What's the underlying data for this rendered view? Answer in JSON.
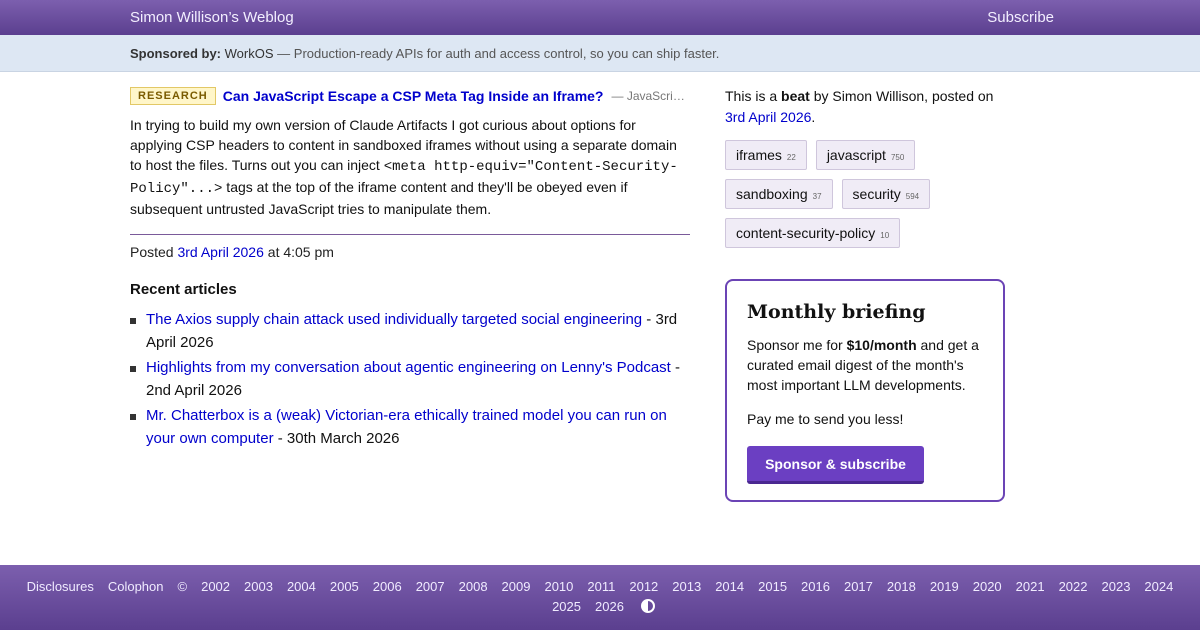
{
  "header": {
    "site_title": "Simon Willison’s Weblog",
    "subscribe": "Subscribe"
  },
  "sponsor_bar": {
    "label": "Sponsored by:",
    "sponsor_name": "WorkOS",
    "tagline": "— Production-ready APIs for auth and access control, so you can ship faster."
  },
  "entry": {
    "badge": "RESEARCH",
    "title": "Can JavaScript Escape a CSP Meta Tag Inside an Iframe?",
    "via": "— JavaScri…",
    "body_1": "In trying to build my own version of Claude Artifacts I got curious about options for applying CSP headers to content in sandboxed iframes without using a separate domain to host the files. Turns out you can inject ",
    "body_code": "<meta http-equiv=\"Content-Security-Policy\"...>",
    "body_2": " tags at the top of the iframe content and they'll be obeyed even if subsequent untrusted JavaScript tries to manipulate them.",
    "posted_prefix": "Posted",
    "posted_date": "3rd April 2026",
    "posted_time": "at 4:05 pm"
  },
  "recent": {
    "heading": "Recent articles",
    "items": [
      {
        "title": "The Axios supply chain attack used individually targeted social engineering",
        "date": " - 3rd April 2026"
      },
      {
        "title": "Highlights from my conversation about agentic engineering on Lenny's Podcast",
        "date": " - 2nd April 2026"
      },
      {
        "title": "Mr. Chatterbox is a (weak) Victorian-era ethically trained model you can run on your own computer",
        "date": " - 30th March 2026"
      }
    ]
  },
  "sidebar": {
    "beat_prefix": "This is a ",
    "beat_word": "beat",
    "beat_suffix": " by Simon Willison, posted on ",
    "beat_date": "3rd April 2026",
    "beat_end": ".",
    "tags": [
      {
        "name": "iframes",
        "count": "22"
      },
      {
        "name": "javascript",
        "count": "750"
      },
      {
        "name": "sandboxing",
        "count": "37"
      },
      {
        "name": "security",
        "count": "594"
      },
      {
        "name": "content-security-policy",
        "count": "10"
      }
    ]
  },
  "briefing": {
    "title": "Monthly briefing",
    "desc_prefix": "Sponsor me for ",
    "desc_price": "$10/month",
    "desc_suffix": " and get a curated email digest of the month's most important LLM developments.",
    "pay": "Pay me to send you less!",
    "button": "Sponsor & subscribe"
  },
  "footer": {
    "items": [
      "Disclosures",
      "Colophon",
      "©",
      "2002",
      "2003",
      "2004",
      "2005",
      "2006",
      "2007",
      "2008",
      "2009",
      "2010",
      "2011",
      "2012",
      "2013",
      "2014",
      "2015",
      "2016",
      "2017",
      "2018",
      "2019",
      "2020",
      "2021",
      "2022",
      "2023",
      "2024",
      "2025",
      "2026"
    ],
    "contrast_icon": "contrast-toggle-icon"
  },
  "colors": {
    "header_purple": "#6a4e9e",
    "sponsor_bar_bg": "#dde7f3",
    "accent_purple": "#6b3fc2",
    "link_blue": "#0000cc",
    "badge_bg": "#fff6c9"
  }
}
